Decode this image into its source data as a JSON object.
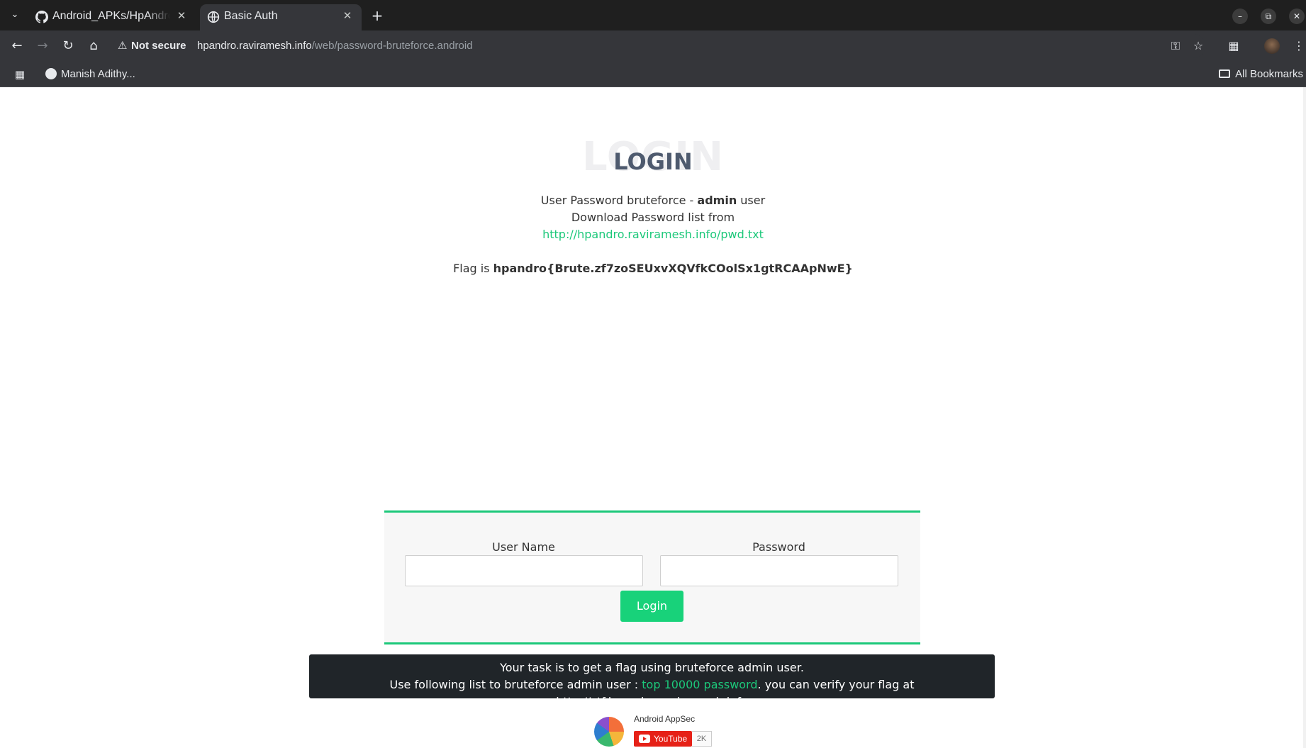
{
  "browser": {
    "tabs": [
      {
        "title": "Android_APKs/HpAndro",
        "icon": "github-icon",
        "active": false
      },
      {
        "title": "Basic Auth",
        "icon": "globe-icon",
        "active": true
      }
    ],
    "new_tab_label": "+",
    "security_label": "Not secure",
    "url_host": "hpandro.raviramesh.info",
    "url_path": "/web/password-bruteforce.android",
    "bookmarks": [
      {
        "label": "Manish Adithy..."
      }
    ],
    "all_bookmarks_label": "All Bookmarks"
  },
  "page": {
    "heading_ghost": "LOGIN",
    "heading": "LOGIN",
    "desc_prefix": "User Password bruteforce - ",
    "desc_bold": "admin",
    "desc_suffix": " user",
    "download_text": "Download Password list from",
    "download_link": "http://hpandro.raviramesh.info/pwd.txt",
    "flag_prefix": "Flag is ",
    "flag_value": "hpandro{Brute.zf7zoSEUxvXQVfkCOolSx1gtRCAApNwE}",
    "form": {
      "username_label": "User Name",
      "password_label": "Password",
      "login_button": "Login"
    },
    "task": {
      "line1": "Your task is to get a flag using bruteforce admin user.",
      "line2_prefix": "Use following list to bruteforce admin user : ",
      "line2_link": "top 10000 password",
      "line2_suffix": ". you can verify your flag at http://ctf.hpandro.raviramesh.info"
    },
    "footer": {
      "channel_name": "Android AppSec",
      "youtube_label": "YouTube",
      "subscriber_count": "2K"
    }
  },
  "colors": {
    "accent_green": "#1cc87a",
    "task_bg": "#202529",
    "youtube_red": "#e62117"
  }
}
